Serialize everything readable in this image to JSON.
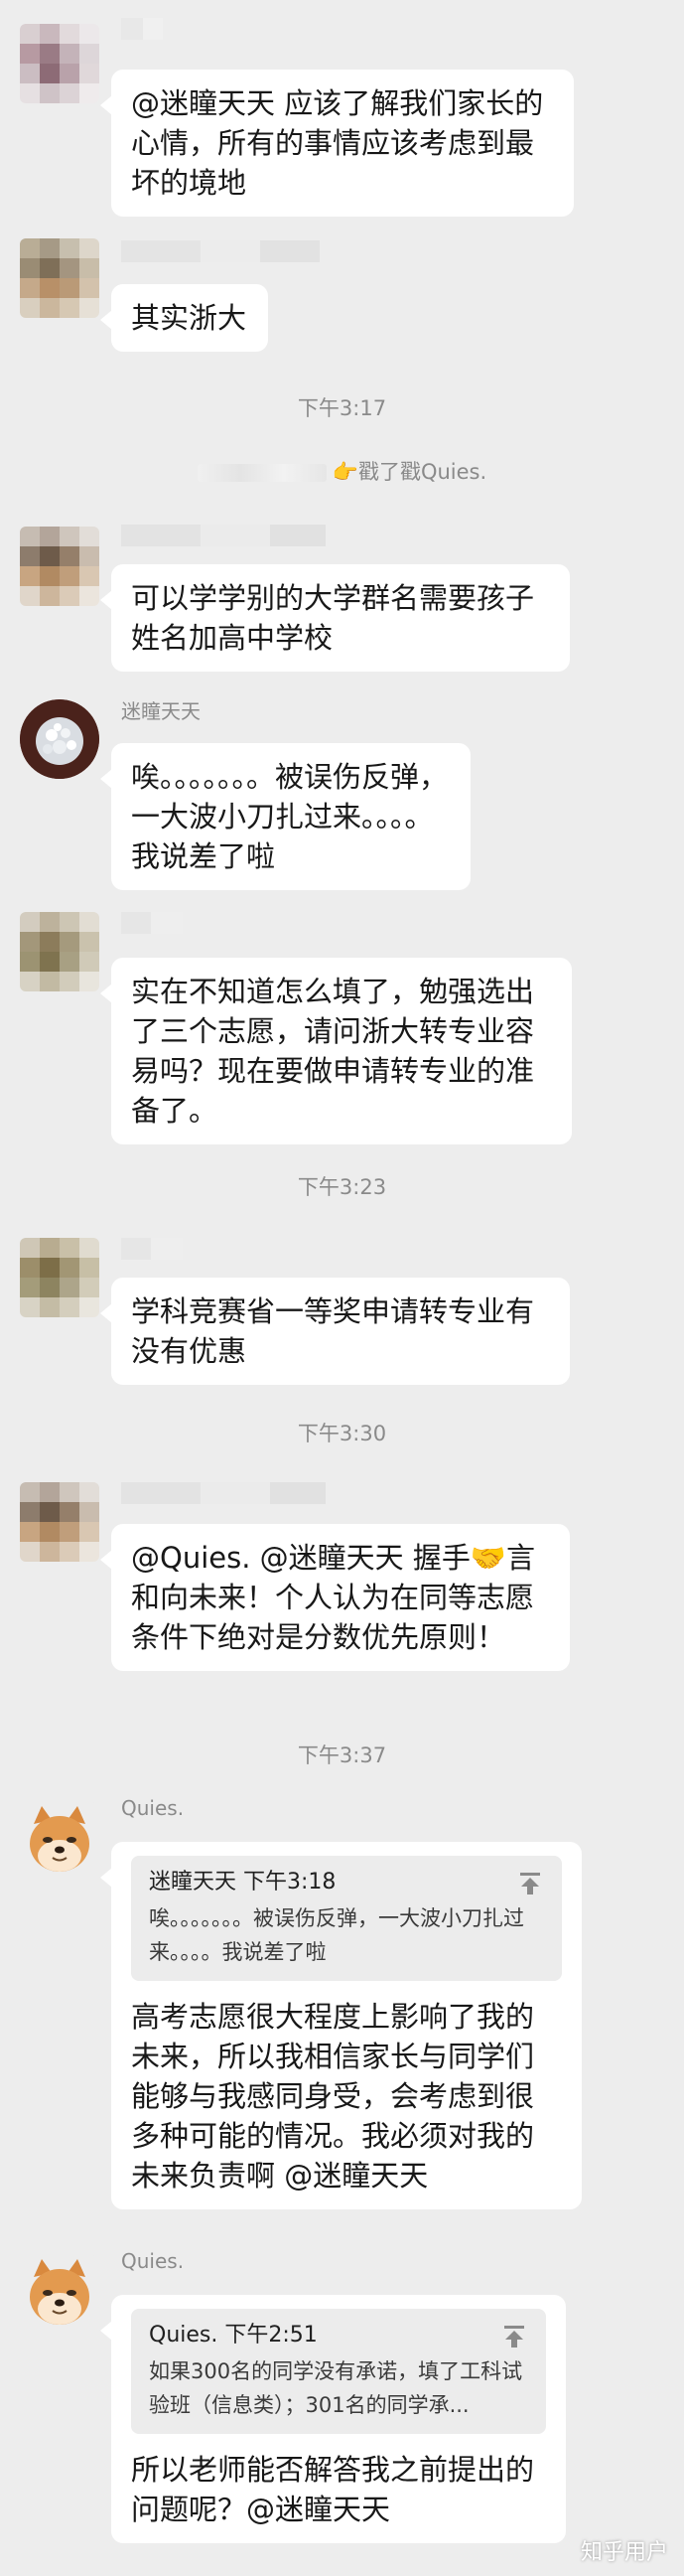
{
  "messages": {
    "m1": {
      "text": "@迷瞳天天 应该了解我们家长的心情，所有的事情应该考虑到最坏的境地"
    },
    "m2": {
      "text": "其实浙大"
    },
    "t1": "下午3:17",
    "system": {
      "text": "戳了戳Quies."
    },
    "m3": {
      "text": "可以学学别的大学群名需要孩子姓名加高中学校"
    },
    "m4": {
      "name": "迷瞳天天",
      "text": "唉。。。。。。。被误伤反弹，一大波小刀扎过来。。。。我说差了啦"
    },
    "m5": {
      "text": "实在不知道怎么填了，勉强选出了三个志愿，请问浙大转专业容易吗？现在要做申请转专业的准备了。"
    },
    "t2": "下午3:23",
    "m6": {
      "text": "学科竞赛省一等奖申请转专业有没有优惠"
    },
    "t3": "下午3:30",
    "m7": {
      "text": "@Quies. @迷瞳天天 握手🤝言和向未来！个人认为在同等志愿条件下绝对是分数优先原则！"
    },
    "t4": "下午3:37",
    "m8": {
      "name": "Quies.",
      "quote_head": "迷瞳天天 下午3:18",
      "quote_body": "唉。。。。。。。被误伤反弹，一大波小刀扎过来。。。。我说差了啦",
      "text": "高考志愿很大程度上影响了我的未来，所以我相信家长与同学们能够与我感同身受，会考虑到很多种可能的情况。我必须对我的未来负责啊 @迷瞳天天"
    },
    "m9": {
      "name": "Quies.",
      "quote_head": "Quies. 下午2:51",
      "quote_body": "如果300名的同学没有承诺，填了工科试验班（信息类）；301名的同学承...",
      "text": "所以老师能否解答我之前提出的问题呢？@迷瞳天天"
    }
  },
  "watermark": "知乎用户",
  "colors": {
    "background": "#ededed",
    "bubble": "#ffffff",
    "meta": "#8a8a8a"
  }
}
